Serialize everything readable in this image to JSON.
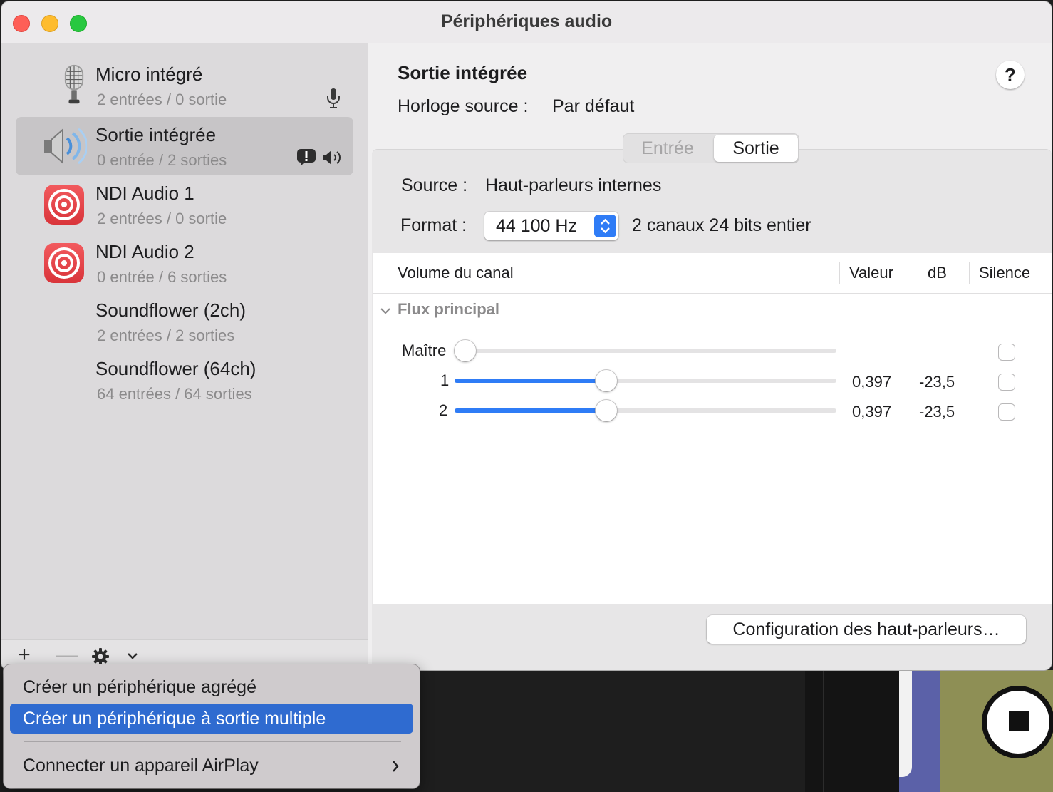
{
  "window": {
    "title": "Périphériques audio"
  },
  "devices": [
    {
      "name": "Micro intégré",
      "io": "2 entrées / 0 sortie",
      "icon": "microphone-icon",
      "selected": false
    },
    {
      "name": "Sortie intégrée",
      "io": "0 entrée / 2 sorties",
      "icon": "speaker-icon",
      "selected": true
    },
    {
      "name": "NDI Audio 1",
      "io": "2 entrées / 0 sortie",
      "icon": "ndi-icon",
      "selected": false
    },
    {
      "name": "NDI Audio 2",
      "io": "0 entrée / 6 sorties",
      "icon": "ndi-icon",
      "selected": false
    },
    {
      "name": "Soundflower (2ch)",
      "io": "2 entrées / 2 sorties",
      "icon": "",
      "selected": false
    },
    {
      "name": "Soundflower (64ch)",
      "io": "64 entrées / 64 sorties",
      "icon": "",
      "selected": false
    }
  ],
  "toolbar": {
    "add": "+",
    "remove": "—"
  },
  "detail": {
    "title": "Sortie intégrée",
    "clock_label": "Horloge source :",
    "clock_value": "Par défaut",
    "help": "?",
    "tabs": [
      "Entrée",
      "Sortie"
    ],
    "active_tab": "Sortie",
    "source_label": "Source :",
    "source_value": "Haut-parleurs internes",
    "format_label": "Format :",
    "format_value": "44 100 Hz",
    "format_detail": "2 canaux 24 bits entier",
    "speaker_button": "Configuration des haut-parleurs…"
  },
  "table": {
    "headers": [
      "Volume du canal",
      "Valeur",
      "dB",
      "Silence"
    ],
    "group": "Flux principal",
    "rows": [
      {
        "label": "Maître",
        "volume": 0.0,
        "value": "",
        "db": "",
        "muted": false
      },
      {
        "label": "1",
        "volume": 0.397,
        "value": "0,397",
        "db": "-23,5",
        "muted": false
      },
      {
        "label": "2",
        "volume": 0.397,
        "value": "0,397",
        "db": "-23,5",
        "muted": false
      }
    ]
  },
  "menu": {
    "items": [
      {
        "label": "Créer un périphérique agrégé",
        "active": false
      },
      {
        "label": "Créer un périphérique à sortie multiple",
        "active": true
      },
      {
        "label": "Connecter un appareil AirPlay",
        "active": false,
        "submenu": true
      }
    ]
  },
  "colors": {
    "accent": "#2f7cf6",
    "menu_highlight": "#2f6bd0",
    "ndi": "#e2434a"
  }
}
